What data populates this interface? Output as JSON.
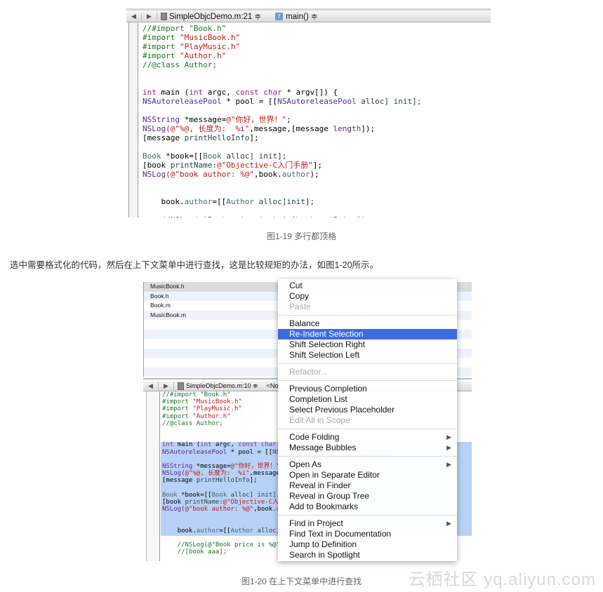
{
  "figure1": {
    "toolbar": {
      "file": "SimpleObjcDemo.m:21 ≑",
      "func": "main() ≑",
      "func_icon": "f"
    },
    "code": [
      [
        [
          "//#import \"Book.h\"",
          "cm"
        ]
      ],
      [
        [
          "#import ",
          "cm"
        ],
        [
          "\"MusicBook.h\"",
          "str"
        ]
      ],
      [
        [
          "#import ",
          "cm"
        ],
        [
          "\"PlayMusic.h\"",
          "str"
        ]
      ],
      [
        [
          "#import ",
          "cm"
        ],
        [
          "\"Author.h\"",
          "str"
        ]
      ],
      [
        [
          "//@class Author;",
          "cm"
        ]
      ],
      [],
      [],
      [
        [
          "int",
          "kw"
        ],
        [
          " main (",
          "pl"
        ],
        [
          "int",
          "kw"
        ],
        [
          " argc, ",
          "pl"
        ],
        [
          "const char",
          "kw"
        ],
        [
          " * argv[]) {",
          "pl"
        ]
      ],
      [
        [
          "NSAutoreleasePool",
          "ty"
        ],
        [
          " * pool = [[",
          "pl"
        ],
        [
          "NSAutoreleasePool",
          "ty"
        ],
        [
          " alloc] init];",
          "fn"
        ]
      ],
      [],
      [
        [
          "NSString",
          "ty"
        ],
        [
          " *message=",
          "pl"
        ],
        [
          "@\"你好，世界！\"",
          "str"
        ],
        [
          ";",
          "pl"
        ]
      ],
      [
        [
          "NSLog(",
          "ty"
        ],
        [
          "@\"%@, 长度为:  %i\"",
          "str"
        ],
        [
          ",message,[message ",
          "pl"
        ],
        [
          "length",
          "ty"
        ],
        [
          "]);",
          "pl"
        ]
      ],
      [
        [
          "[message ",
          "pl"
        ],
        [
          "printHelloInfo",
          "fn"
        ],
        [
          "];",
          "pl"
        ]
      ],
      [],
      [
        [
          "Book",
          "cls"
        ],
        [
          " *book=[[",
          "pl"
        ],
        [
          "Book",
          "cls"
        ],
        [
          " alloc] init];",
          "fn"
        ]
      ],
      [
        [
          "[book ",
          "pl"
        ],
        [
          "printName:",
          "fn"
        ],
        [
          "@\"Objective-C入门手册\"",
          "str"
        ],
        [
          "];",
          "pl"
        ]
      ],
      [
        [
          "NSLog(",
          "ty"
        ],
        [
          "@\"book author: %@\"",
          "str"
        ],
        [
          ",book.",
          "pl"
        ],
        [
          "author",
          "cls"
        ],
        [
          ");",
          "pl"
        ]
      ],
      [],
      [],
      [
        [
          "    book.",
          "pl"
        ],
        [
          "author",
          "cls"
        ],
        [
          "=[[",
          "pl"
        ],
        [
          "Author",
          "cls"
        ],
        [
          " alloc]init];",
          "fn"
        ]
      ],
      [],
      [
        [
          "    //NSLog(@\"Book price is %@\",[book getPrice]);",
          "cm"
        ]
      ]
    ],
    "caption": "图1-19 多行都顶格"
  },
  "paragraph": "选中需要格式化的代码，然后在上下文菜单中进行查找，这是比较规矩的办法，如图1-20所示。",
  "figure2": {
    "files": [
      "MusicBook.h",
      "Book.h",
      "Book.m",
      "MusicBook.m"
    ],
    "toolbar": {
      "file": "SimpleObjcDemo.m:10 ≑",
      "func": "<No"
    },
    "code_extra": [
      [
        [
          "    //[book aaa];",
          "cm"
        ]
      ]
    ],
    "menu": [
      [
        {
          "label": "Cut"
        },
        {
          "label": "Copy"
        },
        {
          "label": "Paste",
          "disabled": true
        }
      ],
      [
        {
          "label": "Balance"
        },
        {
          "label": "Re-Indent Selection",
          "highlighted": true
        },
        {
          "label": "Shift Selection Right"
        },
        {
          "label": "Shift Selection Left"
        }
      ],
      [
        {
          "label": "Refactor...",
          "disabled": true
        }
      ],
      [
        {
          "label": "Previous Completion"
        },
        {
          "label": "Completion List"
        },
        {
          "label": "Select Previous Placeholder"
        },
        {
          "label": "Edit All in Scope",
          "disabled": true
        }
      ],
      [
        {
          "label": "Code Folding",
          "submenu": true
        },
        {
          "label": "Message Bubbles",
          "submenu": true
        }
      ],
      [
        {
          "label": "Open As",
          "submenu": true
        },
        {
          "label": "Open in Separate Editor"
        },
        {
          "label": "Reveal in Finder"
        },
        {
          "label": "Reveal in Group Tree"
        },
        {
          "label": "Add to Bookmarks"
        }
      ],
      [
        {
          "label": "Find in Project",
          "submenu": true
        },
        {
          "label": "Find Text in Documentation"
        },
        {
          "label": "Jump to Definition"
        },
        {
          "label": "Search in Spotlight"
        }
      ]
    ],
    "caption": "图1-20 在上下文菜单中进行查找"
  },
  "watermark": "云栖社区 yq.aliyun.com",
  "colors": {
    "selection": "#b8d1f6",
    "menu_highlight": "#3d6be0",
    "comment": "#177b1e",
    "string": "#c41a16",
    "keyword": "#a0208f"
  }
}
